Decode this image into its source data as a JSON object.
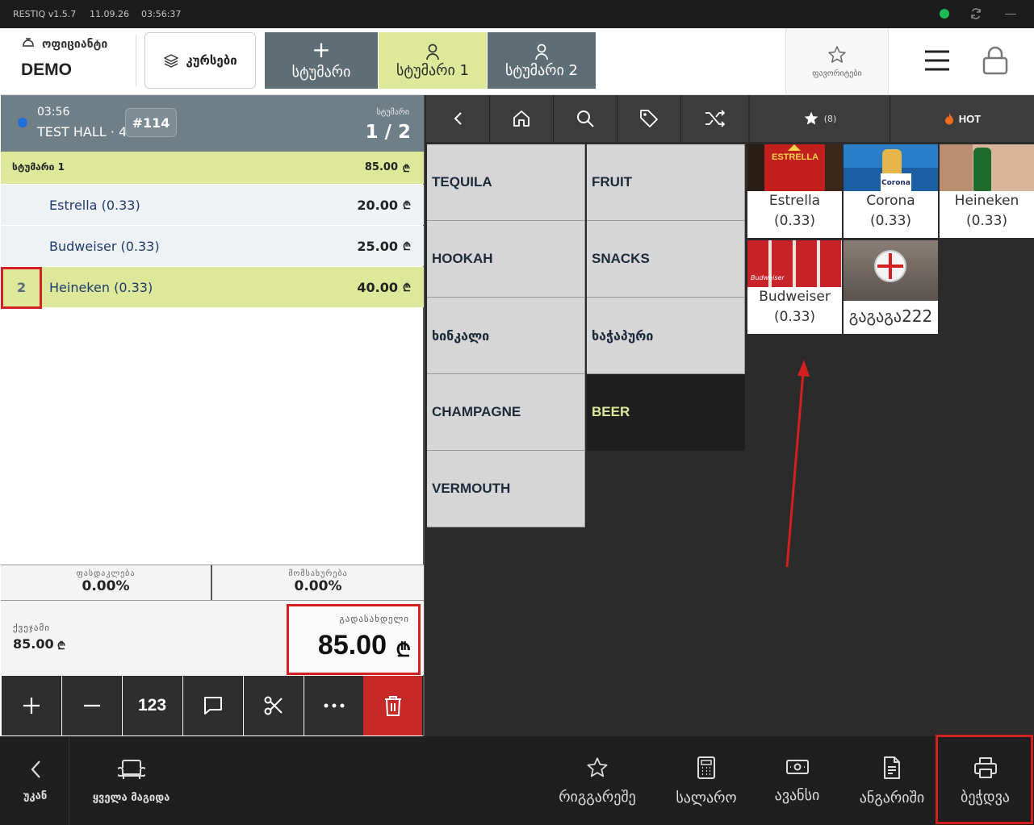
{
  "titlebar": {
    "app": "RESTIQ v1.5.7",
    "date": "11.09.26",
    "time": "03:56:37"
  },
  "header": {
    "role": "ოფიციანტი",
    "user": "DEMO",
    "courses_label": "კურსები",
    "add_guest_label": "სტუმარი",
    "guest1_label": "სტუმარი 1",
    "guest2_label": "სტუმარი 2",
    "favorites_label": "ფავორიტები"
  },
  "order": {
    "time": "03:56",
    "hall": "TEST HALL · 4",
    "number": "#114",
    "guest_caption": "სტუმარი",
    "guest_count": "1 / 2",
    "group_label": "სტუმარი 1",
    "group_total": "85.00",
    "currency": "₾",
    "items": [
      {
        "qty": "",
        "name": "Estrella (0.33)",
        "price": "20.00"
      },
      {
        "qty": "",
        "name": "Budweiser (0.33)",
        "price": "25.00"
      },
      {
        "qty": "2",
        "name": "Heineken (0.33)",
        "price": "40.00"
      }
    ],
    "discount_label": "ფასდაკლება",
    "discount_value": "0.00%",
    "service_label": "მომსახურება",
    "service_value": "0.00%",
    "subtotal_label": "ქვეჯამი",
    "subtotal_value": "85.00",
    "to_pay_label": "გადასახდელი",
    "to_pay_value": "85.00"
  },
  "actions": {
    "numpad_label": "123"
  },
  "catalog": {
    "favorites_count": "(8)",
    "hot_label": "HOT",
    "categories": [
      {
        "label": "TEQUILA"
      },
      {
        "label": "FRUIT"
      },
      {
        "label": "HOOKAH"
      },
      {
        "label": "SNACKS"
      },
      {
        "label": "ხინკალი"
      },
      {
        "label": "ხაჭაპური"
      },
      {
        "label": "CHAMPAGNE"
      },
      {
        "label": "BEER"
      },
      {
        "label": "VERMOUTH"
      }
    ],
    "products": [
      {
        "name": "Estrella",
        "size": "(0.33)"
      },
      {
        "name": "Corona",
        "size": "(0.33)"
      },
      {
        "name": "Heineken",
        "size": "(0.33)"
      },
      {
        "name": "Budweiser",
        "size": "(0.33)"
      },
      {
        "name": "გაგაგა222",
        "size": ""
      }
    ],
    "image_text": {
      "estrella": "ESTRELLA",
      "corona": "Corona",
      "budweiser": "Budweiser"
    }
  },
  "bottom_nav": {
    "back": "უკან",
    "all_tables": "ყველა მაგიდა",
    "queue": "რიგგარეშე",
    "cashier": "სალარო",
    "advance": "ავანსი",
    "invoice": "ანგარიში",
    "print": "ბეჭდვა"
  },
  "colors": {
    "accent_yellow": "#dde89a",
    "danger": "#c62828",
    "highlight": "#d32020",
    "status_online": "#1db954"
  }
}
